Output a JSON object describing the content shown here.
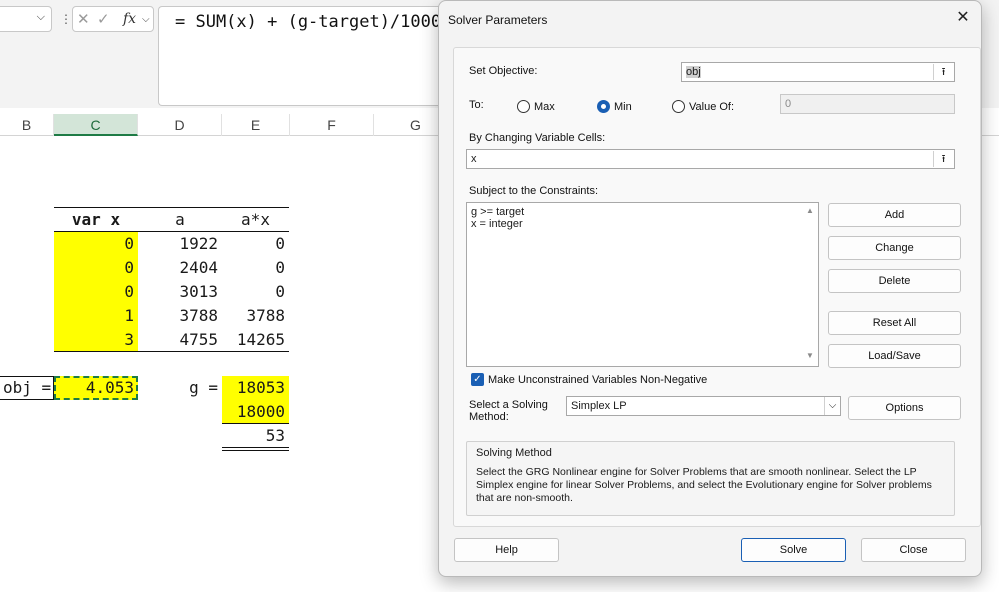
{
  "formula_bar": {
    "name_box_chevron": "⌵",
    "separator": "⋮",
    "cancel_icon": "✕",
    "enter_icon": "✓",
    "fx_label": "fx",
    "fx_chevron": "⌵",
    "formula": "= SUM(x) + (g-target)/1000"
  },
  "columns": [
    "B",
    "C",
    "D",
    "E",
    "F",
    "G"
  ],
  "sheet": {
    "headers": [
      "var x",
      "a",
      "a*x"
    ],
    "var_x": [
      "0",
      "0",
      "0",
      "1",
      "3"
    ],
    "a": [
      "1922",
      "2404",
      "3013",
      "3788",
      "4755"
    ],
    "ax": [
      "0",
      "0",
      "0",
      "3788",
      "14265"
    ],
    "obj_label": "obj =",
    "obj_value": "4.053",
    "g_label": "g =",
    "g_value": "18053",
    "target_value": "18000",
    "diff_value": "53"
  },
  "dialog": {
    "title": "Solver Parameters",
    "close_icon": "✕",
    "set_objective_label": "Set Objective:",
    "objective_value": "obj",
    "ref_icon": "⭱",
    "to_label": "To:",
    "max_label": "Max",
    "min_label": "Min",
    "value_of_label": "Value Of:",
    "value_of_value": "0",
    "selected_goal": "Min",
    "changing_cells_label": "By Changing Variable Cells:",
    "changing_cells_value": "x",
    "constraints_label": "Subject to the Constraints:",
    "constraints": [
      "g >= target",
      "x = integer"
    ],
    "add_label": "Add",
    "change_label": "Change",
    "delete_label": "Delete",
    "reset_all_label": "Reset All",
    "load_save_label": "Load/Save",
    "nonneg_label": "Make Unconstrained Variables Non-Negative",
    "nonneg_checked": true,
    "method_label_1": "Select a Solving",
    "method_label_2": "Method:",
    "method_value": "Simplex LP",
    "options_label": "Options",
    "solving_method_title": "Solving Method",
    "solving_method_text": "Select the GRG Nonlinear engine for Solver Problems that are smooth nonlinear. Select the LP Simplex engine for linear Solver Problems, and select the Evolutionary engine for Solver problems that are non-smooth.",
    "help_label": "Help",
    "solve_label": "Solve",
    "close_label": "Close"
  },
  "colors": {
    "highlight": "#ffff00",
    "accent": "#1a5fb4",
    "selected_column": "#d3e5d8"
  }
}
